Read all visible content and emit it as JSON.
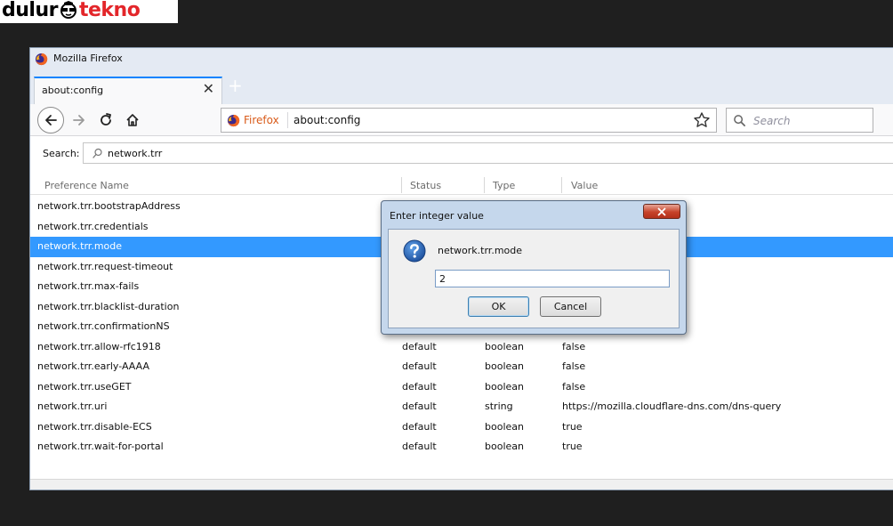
{
  "watermark": {
    "part1": "dulur",
    "part2": "tekno"
  },
  "window": {
    "title": "Mozilla Firefox"
  },
  "tab": {
    "title": "about:config",
    "close_glyph": "✕",
    "new_tab_glyph": "+"
  },
  "urlbar": {
    "identity": "Firefox",
    "url": "about:config"
  },
  "searchbar": {
    "placeholder": "Search"
  },
  "config": {
    "search_label": "Search:",
    "filter": "network.trr",
    "columns": {
      "name": "Preference Name",
      "status": "Status",
      "type": "Type",
      "value": "Value"
    },
    "rows": [
      {
        "name": "network.trr.bootstrapAddress",
        "status": "",
        "type": "",
        "value": ""
      },
      {
        "name": "network.trr.credentials",
        "status": "",
        "type": "",
        "value": ""
      },
      {
        "name": "network.trr.mode",
        "status": "",
        "type": "",
        "value": ""
      },
      {
        "name": "network.trr.request-timeout",
        "status": "",
        "type": "",
        "value": ""
      },
      {
        "name": "network.trr.max-fails",
        "status": "",
        "type": "",
        "value": ""
      },
      {
        "name": "network.trr.blacklist-duration",
        "status": "",
        "type": "",
        "value": ""
      },
      {
        "name": "network.trr.confirmationNS",
        "status": "",
        "type": "",
        "value": ""
      },
      {
        "name": "network.trr.allow-rfc1918",
        "status": "default",
        "type": "boolean",
        "value": "false"
      },
      {
        "name": "network.trr.early-AAAA",
        "status": "default",
        "type": "boolean",
        "value": "false"
      },
      {
        "name": "network.trr.useGET",
        "status": "default",
        "type": "boolean",
        "value": "false"
      },
      {
        "name": "network.trr.uri",
        "status": "default",
        "type": "string",
        "value": "https://mozilla.cloudflare-dns.com/dns-query"
      },
      {
        "name": "network.trr.disable-ECS",
        "status": "default",
        "type": "boolean",
        "value": "true"
      },
      {
        "name": "network.trr.wait-for-portal",
        "status": "default",
        "type": "boolean",
        "value": "true"
      }
    ],
    "selected_index": 2
  },
  "dialog": {
    "title": "Enter integer value",
    "message": "network.trr.mode",
    "input_value": "2",
    "ok_label": "OK",
    "cancel_label": "Cancel"
  },
  "icons": {
    "back": "back-arrow-icon",
    "forward": "forward-arrow-icon",
    "reload": "reload-icon",
    "home": "home-icon",
    "bookmark": "star-icon",
    "search": "magnifier-icon",
    "question": "question-icon",
    "close": "close-icon"
  },
  "colors": {
    "selection": "#3399ff",
    "dialog_frame": "#c5d7ec",
    "firefox_identity": "#d95b1a",
    "tab_accent": "#0a84ff"
  }
}
